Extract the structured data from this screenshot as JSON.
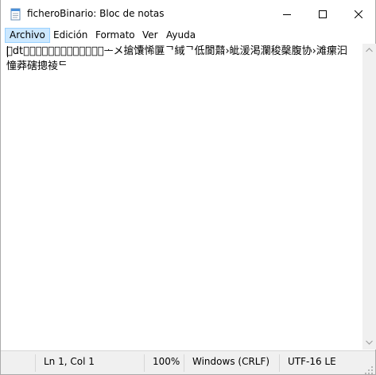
{
  "window": {
    "title": "ficheroBinario: Bloc de notas",
    "app_icon": "notepad-icon"
  },
  "controls": {
    "minimize_icon": "minimize-icon",
    "maximize_icon": "maximize-icon",
    "close_icon": "close-icon"
  },
  "menu": {
    "items": [
      {
        "label": "Archivo",
        "active": true
      },
      {
        "label": "Edición"
      },
      {
        "label": "Formato"
      },
      {
        "label": "Ver"
      },
      {
        "label": "Ayuda"
      }
    ]
  },
  "editor": {
    "content": "\u0000dt\u0004\u0000\u0000\u0000\u0000\u0000\u0000\u0000\u0000\u0000\u0000\u0000\u0000ᅩメ搶馕悕匴ᄀ緎ᄀ低閬鼘›皉湲渇瀾稄䅽腹协›滩瘰汩憧莽磍摠祾ᄃ"
  },
  "status": {
    "position": "Ln 1, Col 1",
    "zoom": "100%",
    "line_ending": "Windows (CRLF)",
    "encoding": "UTF-16 LE"
  }
}
